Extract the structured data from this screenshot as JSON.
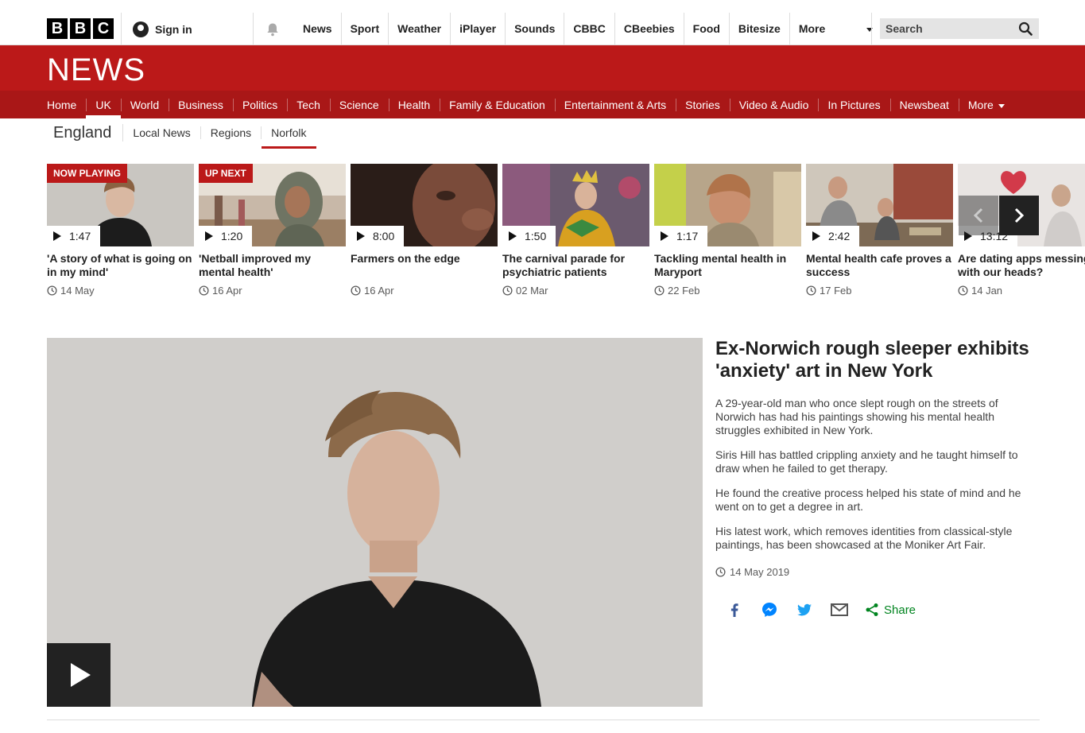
{
  "bbc_letters": [
    "B",
    "B",
    "C"
  ],
  "account": {
    "signin_label": "Sign in"
  },
  "topnav": {
    "items": [
      "News",
      "Sport",
      "Weather",
      "iPlayer",
      "Sounds",
      "CBBC",
      "CBeebies",
      "Food",
      "Bitesize"
    ],
    "more_label": "More"
  },
  "search": {
    "placeholder": "Search"
  },
  "banner": {
    "wordmark": "NEWS"
  },
  "mainnav": {
    "items": [
      "Home",
      "UK",
      "World",
      "Business",
      "Politics",
      "Tech",
      "Science",
      "Health",
      "Family & Education",
      "Entertainment & Arts",
      "Stories",
      "Video & Audio",
      "In Pictures",
      "Newsbeat"
    ],
    "active": "UK",
    "more_label": "More"
  },
  "subnav": {
    "region": "England",
    "items": [
      "Local News",
      "Regions",
      "Norfolk"
    ],
    "active": "Norfolk"
  },
  "carousel": [
    {
      "badge": "NOW PLAYING",
      "duration": "1:47",
      "title": "'A story of what is going on in my mind'",
      "date": "14 May"
    },
    {
      "badge": "UP NEXT",
      "duration": "1:20",
      "title": "'Netball improved my mental health'",
      "date": "16 Apr"
    },
    {
      "badge": "",
      "duration": "8:00",
      "title": "Farmers on the edge",
      "date": "16 Apr"
    },
    {
      "badge": "",
      "duration": "1:50",
      "title": "The carnival parade for psychiatric patients",
      "date": "02 Mar"
    },
    {
      "badge": "",
      "duration": "1:17",
      "title": "Tackling mental health in Maryport",
      "date": "22 Feb"
    },
    {
      "badge": "",
      "duration": "2:42",
      "title": "Mental health cafe proves a success",
      "date": "17 Feb"
    },
    {
      "badge": "",
      "duration": "13:12",
      "title": "Are dating apps messing with our heads?",
      "date": "14 Jan"
    }
  ],
  "article": {
    "headline": "Ex-Norwich rough sleeper exhibits 'anxiety' art in New York",
    "paragraphs": [
      "A 29-year-old man who once slept rough on the streets of Norwich has had his paintings showing his mental health struggles exhibited in New York.",
      "Siris Hill has battled crippling anxiety and he taught himself to draw when he failed to get therapy.",
      "He found the creative process helped his state of mind and he went on to get a degree in art.",
      "His latest work, which removes identities from classical-style paintings, has been showcased at the Moniker Art Fair."
    ],
    "date": "14 May 2019",
    "share_label": "Share"
  },
  "colors": {
    "brand_red": "#bb1919",
    "nav_red": "#a91717",
    "share_green": "#00841f"
  }
}
